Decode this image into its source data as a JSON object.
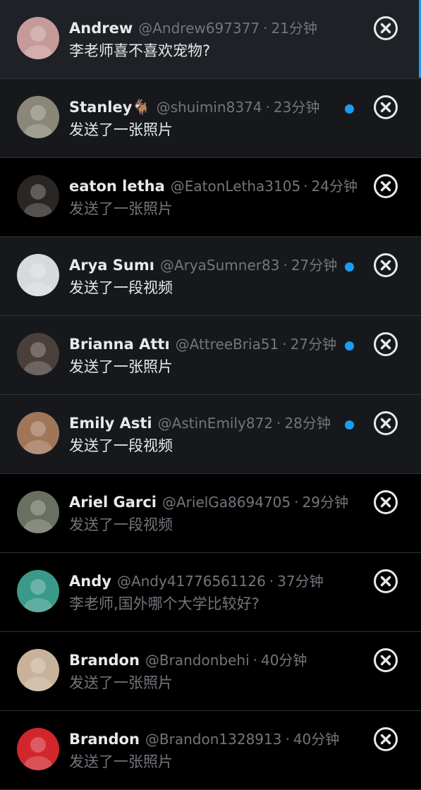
{
  "conversations": [
    {
      "name": "Andrew",
      "handle": "@Andrew697377",
      "sep": "·",
      "time": "21分钟",
      "preview": "李老师喜不喜欢宠物?",
      "state": "selected",
      "unread_dot": false,
      "avatar_color": "#c79a9a"
    },
    {
      "name": "Stanley🐐",
      "handle": "@shuimin8374",
      "sep": "·",
      "time": "23分钟",
      "preview": "发送了一张照片",
      "state": "unread",
      "unread_dot": true,
      "avatar_color": "#8a8778"
    },
    {
      "name": "eaton letha",
      "handle": "@EatonLetha3105",
      "sep": "·",
      "time": "24分钟",
      "preview": "发送了一张照片",
      "state": "read",
      "unread_dot": false,
      "avatar_color": "#2a2624"
    },
    {
      "name": "Arya Sumı",
      "handle": "@AryaSumner83",
      "sep": "·",
      "time": "27分钟",
      "preview": "发送了一段视频",
      "state": "unread",
      "unread_dot": true,
      "avatar_color": "#d7d9dc"
    },
    {
      "name": "Brianna Attı",
      "handle": "@AttreeBria51",
      "sep": "·",
      "time": "27分钟",
      "preview": "发送了一张照片",
      "state": "unread",
      "unread_dot": true,
      "avatar_color": "#4a3f3a"
    },
    {
      "name": "Emily Asti",
      "handle": "@AstinEmily872",
      "sep": "·",
      "time": "28分钟",
      "preview": "发送了一段视频",
      "state": "unread",
      "unread_dot": true,
      "avatar_color": "#a07658"
    },
    {
      "name": "Ariel Garci",
      "handle": "@ArielGa8694705",
      "sep": "·",
      "time": "29分钟",
      "preview": "发送了一段视频",
      "state": "read",
      "unread_dot": false,
      "avatar_color": "#6a7060"
    },
    {
      "name": "Andy",
      "handle": "@Andy41776561126",
      "sep": "·",
      "time": "37分钟",
      "preview": "李老师,国外哪个大学比较好?",
      "state": "read",
      "unread_dot": false,
      "avatar_color": "#3a9a8a"
    },
    {
      "name": "Brandon",
      "handle": "@Brandonbehi",
      "sep": "·",
      "time": "40分钟",
      "preview": "发送了一张照片",
      "state": "read",
      "unread_dot": false,
      "avatar_color": "#c9b29a"
    },
    {
      "name": "Brandon",
      "handle": "@Brandon1328913",
      "sep": "·",
      "time": "40分钟",
      "preview": "发送了一张照片",
      "state": "read",
      "unread_dot": false,
      "avatar_color": "#d1262c"
    }
  ],
  "icons": {
    "avatar": "avatar-image",
    "close": "close-circle-icon"
  },
  "colors": {
    "accent": "#1d9bf0",
    "text_primary": "#e7e9ea",
    "text_secondary": "#71767b",
    "unread_bg": "#16181c",
    "selected_bg": "#1e2126"
  }
}
